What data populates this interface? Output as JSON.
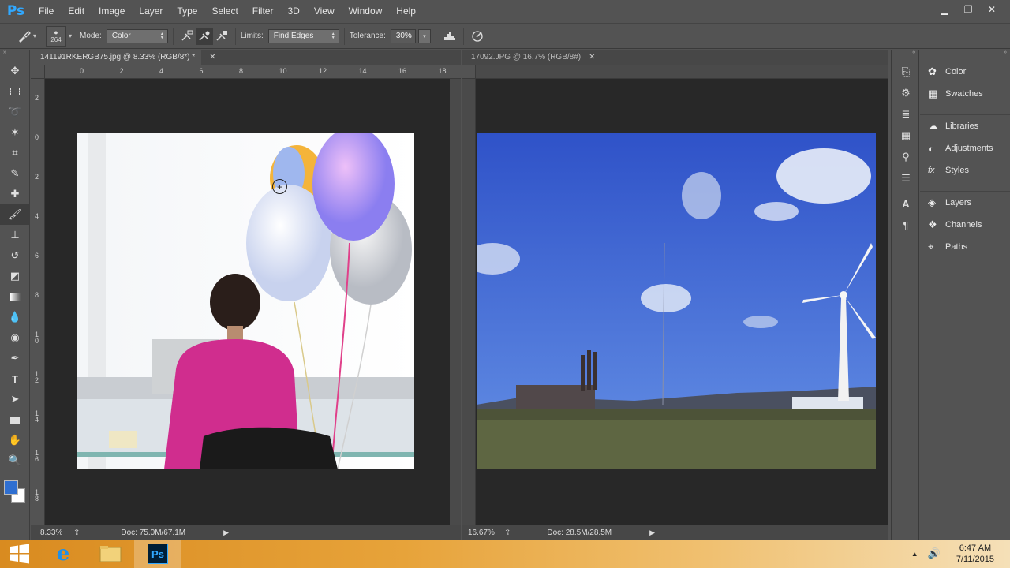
{
  "app": {
    "logo": "Ps"
  },
  "menu": [
    "File",
    "Edit",
    "Image",
    "Layer",
    "Type",
    "Select",
    "Filter",
    "3D",
    "View",
    "Window",
    "Help"
  ],
  "options": {
    "brush_size": "264",
    "mode_label": "Mode:",
    "mode_value": "Color",
    "limits_label": "Limits:",
    "limits_value": "Find Edges",
    "tolerance_label": "Tolerance:",
    "tolerance_value": "30%"
  },
  "doc1": {
    "tab": "141191RKERGB75.jpg @ 8.33% (RGB/8*) *",
    "ruler_h": [
      "0",
      "2",
      "4",
      "6",
      "8",
      "10",
      "12",
      "14",
      "16",
      "18"
    ],
    "ruler_v": [
      "2",
      "0",
      "2",
      "4",
      "6",
      "8",
      "1\n0",
      "1\n2",
      "1\n4",
      "1\n6",
      "1\n8"
    ],
    "zoom": "8.33%",
    "doc_size": "Doc: 75.0M/67.1M"
  },
  "doc2": {
    "tab": "17092.JPG @ 16.7% (RGB/8#)",
    "zoom": "16.67%",
    "doc_size": "Doc: 28.5M/28.5M"
  },
  "panels": [
    {
      "label": "Color",
      "icon": "color-wheel-icon"
    },
    {
      "label": "Swatches",
      "icon": "grid-icon"
    },
    {
      "label": "Libraries",
      "icon": "cloud-icon"
    },
    {
      "label": "Adjustments",
      "icon": "half-circle-icon"
    },
    {
      "label": "Styles",
      "icon": "fx-icon"
    },
    {
      "label": "Layers",
      "icon": "layers-icon"
    },
    {
      "label": "Channels",
      "icon": "channels-icon"
    },
    {
      "label": "Paths",
      "icon": "pen-path-icon"
    }
  ],
  "taskbar": {
    "time": "6:47 AM",
    "date": "7/11/2015",
    "ps_label": "Ps"
  },
  "colors": {
    "foreground": "#2f6fd1",
    "background": "#ffffff"
  }
}
